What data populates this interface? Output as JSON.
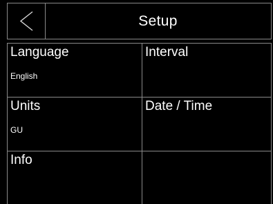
{
  "header": {
    "title": "Setup",
    "back_icon": "chevron-left-icon"
  },
  "menu": {
    "items": [
      {
        "label": "Language",
        "value": "English"
      },
      {
        "label": "Interval",
        "value": ""
      },
      {
        "label": "Units",
        "value": "GU"
      },
      {
        "label": "Date / Time",
        "value": ""
      },
      {
        "label": "Info",
        "value": ""
      },
      {
        "label": "",
        "value": ""
      }
    ]
  },
  "colors": {
    "background": "#000000",
    "border": "#8a8a8a",
    "text": "#ffffff"
  }
}
